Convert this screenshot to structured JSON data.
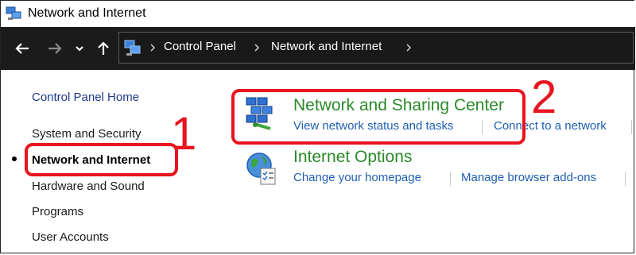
{
  "window": {
    "title": "Network and Internet",
    "icon": "network-globe-icon"
  },
  "address_bar": {
    "breadcrumbs": [
      "Control Panel",
      "Network and Internet"
    ],
    "back_icon": "arrow-left-icon",
    "forward_icon": "arrow-right-icon",
    "recent_icon": "chevron-down-icon",
    "up_icon": "arrow-up-icon"
  },
  "sidebar": {
    "items": [
      {
        "label": "Control Panel Home"
      },
      {
        "label": "System and Security"
      },
      {
        "label": "Network and Internet",
        "selected": true
      },
      {
        "label": "Hardware and Sound"
      },
      {
        "label": "Programs"
      },
      {
        "label": "User Accounts"
      }
    ]
  },
  "categories": [
    {
      "title": "Network and Sharing Center",
      "icon": "network-sharing-icon",
      "tasks": [
        "View network status and tasks",
        "Connect to a network"
      ]
    },
    {
      "title": "Internet Options",
      "icon": "internet-options-icon",
      "tasks": [
        "Change your homepage",
        "Manage browser add-ons"
      ]
    }
  ],
  "annotations": {
    "label_1": "1",
    "label_2": "2",
    "color": "#e8141f"
  },
  "colors": {
    "category_title": "#2a8a2a",
    "task_link": "#1f5fb3",
    "address_bar_bg": "#1b1b1b"
  }
}
